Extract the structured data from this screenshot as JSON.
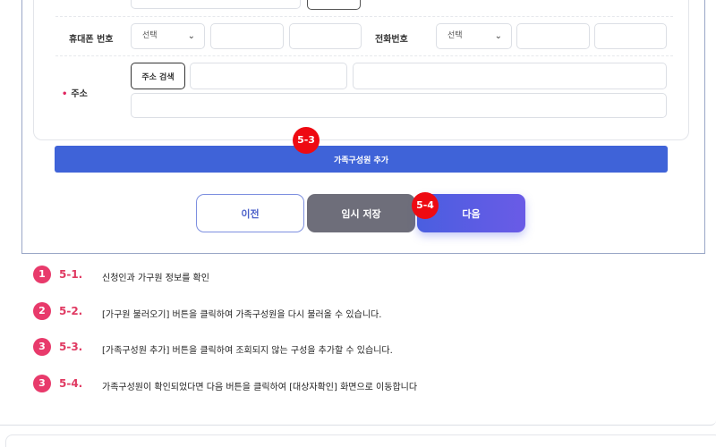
{
  "form": {
    "mobile_label": "휴대폰 번호",
    "mobile_select": "선택",
    "phone_label": "전화번호",
    "phone_select": "선택",
    "address_required": "•",
    "address_label": "주소",
    "address_search_button": "주소 검색",
    "add_member_button": "가족구성원 추가"
  },
  "actions": {
    "prev": "이전",
    "temp_save": "임시 저장",
    "next": "다음"
  },
  "markers": {
    "m53": "5-3",
    "m54": "5-4"
  },
  "steps": [
    {
      "num": "1",
      "code": "5-1.",
      "text": "신청인과 가구원 정보를 확인"
    },
    {
      "num": "2",
      "code": "5-2.",
      "text": "[가구원 불러오기] 버튼을 클릭하여 가족구성원을 다시 불러올 수 있습니다."
    },
    {
      "num": "3",
      "code": "5-3.",
      "text": "[가족구성원 추가] 버튼을 클릭하여 조회되지 않는 구성을 추가할 수 있습니다."
    },
    {
      "num": "3",
      "code": "5-4.",
      "text": "가족구성원이 확인되었다면 다음 버튼을 클릭하여 [대상자확인] 화면으로 이동합니다"
    }
  ]
}
